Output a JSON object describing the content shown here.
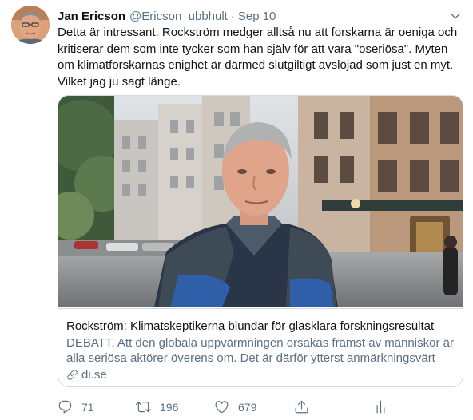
{
  "tweet": {
    "display_name": "Jan Ericson",
    "handle": "@Ericson_ubbhult",
    "separator": "·",
    "date": "Sep 10",
    "text": "Detta är intressant. Rockström medger alltså nu att forskarna är oeniga och kritiserar dem som inte tycker som han själv för att vara \"oseriösa\". Myten om klimatforskarnas enighet är därmed slutgiltigt avslöjad som just en myt. Vilket jag ju sagt länge."
  },
  "card": {
    "title": "Rockström: Klimatskeptikerna blundar för glasklara forskningsresultat",
    "description": "DEBATT. Att den globala uppvärmningen orsakas främst av människor är alla seriösa aktörer överens om. Det är därför ytterst anmärkningsvärt at...",
    "domain": "di.se"
  },
  "actions": {
    "replies": "71",
    "retweets": "196",
    "likes": "679"
  },
  "icons": [
    "chevron-down-icon",
    "link-icon",
    "reply-icon",
    "retweet-icon",
    "like-icon",
    "share-icon",
    "analytics-icon"
  ],
  "colors": {
    "text_primary": "#0f1419",
    "text_secondary": "#5b7083",
    "border": "#cfd9de"
  }
}
